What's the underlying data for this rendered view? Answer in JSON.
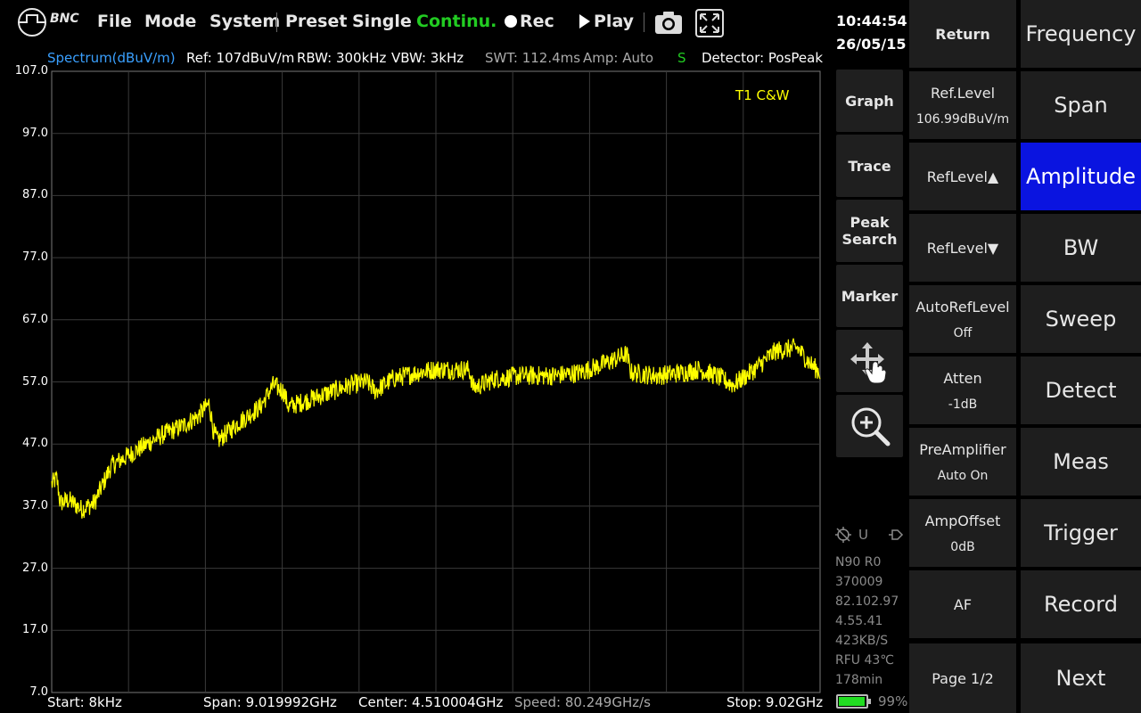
{
  "brand": "BNC",
  "menu": {
    "file": "File",
    "mode": "Mode",
    "system": "System",
    "preset": "Preset",
    "single": "Single",
    "continuous": "Continu.",
    "rec": "Rec",
    "play": "Play"
  },
  "clock": {
    "time": "10:44:54",
    "date": "26/05/15"
  },
  "status": {
    "spectrum": "Spectrum(dBuV/m)",
    "ref": "Ref: 107dBuV/m",
    "rbw": "RBW: 300kHz",
    "vbw": "VBW: 3kHz",
    "swt": "SWT: 112.4ms",
    "amp": "Amp: Auto",
    "s": "S",
    "detector": "Detector: PosPeak"
  },
  "plot": {
    "trace_label": "T1 C&W",
    "y_ticks": [
      "107.0",
      "97.0",
      "87.0",
      "77.0",
      "67.0",
      "57.0",
      "47.0",
      "37.0",
      "27.0",
      "17.0",
      "7.0"
    ]
  },
  "bottom": {
    "start": "Start: 8kHz",
    "span": "Span: 9.019992GHz",
    "center": "Center: 4.510004GHz",
    "speed": "Speed: 80.249GHz/s",
    "stop": "Stop: 9.02GHz"
  },
  "side": {
    "graph": "Graph",
    "trace": "Trace",
    "peak_search": "Peak Search",
    "marker": "Marker"
  },
  "info": {
    "u": "U",
    "lines": [
      "N90 R0",
      "370009",
      "82.102.97",
      "4.55.41",
      "423KB/S",
      "RFU  43℃",
      "178min"
    ],
    "battery": "99%"
  },
  "softkeys": {
    "return": "Return",
    "ref_level": "Ref.Level",
    "ref_level_val": "106.99dBuV/m",
    "ref_up": "RefLevel▲",
    "ref_down": "RefLevel▼",
    "auto_ref": "AutoRefLevel",
    "auto_ref_val": "Off",
    "atten": "Atten",
    "atten_val": "-1dB",
    "preamp": "PreAmplifier",
    "preamp_val": "Auto On",
    "ampoffset": "AmpOffset",
    "ampoffset_val": "0dB",
    "af": "AF",
    "page": "Page 1/2"
  },
  "mainmenu": {
    "frequency": "Frequency",
    "span": "Span",
    "amplitude": "Amplitude",
    "bw": "BW",
    "sweep": "Sweep",
    "detect": "Detect",
    "meas": "Meas",
    "trigger": "Trigger",
    "record": "Record",
    "next": "Next"
  },
  "colors": {
    "trace": "#ffff00",
    "active": "#0a14e0",
    "cont": "#22cc22",
    "spectrum_label": "#3aa0ff"
  },
  "trace_data": {
    "x_unit": "GHz",
    "y_unit": "dBuV/m",
    "points": [
      [
        0.0,
        40.5
      ],
      [
        0.06,
        41.5
      ],
      [
        0.1,
        37.5
      ],
      [
        0.2,
        38.0
      ],
      [
        0.35,
        36.5
      ],
      [
        0.5,
        37.5
      ],
      [
        0.7,
        43.5
      ],
      [
        1.0,
        46.0
      ],
      [
        1.3,
        48.5
      ],
      [
        1.55,
        50.0
      ],
      [
        1.72,
        51.5
      ],
      [
        1.85,
        53.5
      ],
      [
        1.9,
        49.0
      ],
      [
        1.95,
        47.5
      ],
      [
        2.2,
        50.5
      ],
      [
        2.45,
        53.0
      ],
      [
        2.6,
        56.5
      ],
      [
        2.72,
        55.5
      ],
      [
        2.78,
        53.0
      ],
      [
        3.1,
        54.5
      ],
      [
        3.3,
        55.5
      ],
      [
        3.5,
        56.5
      ],
      [
        3.7,
        57.0
      ],
      [
        3.8,
        55.5
      ],
      [
        4.0,
        57.5
      ],
      [
        4.3,
        58.5
      ],
      [
        4.5,
        59.0
      ],
      [
        4.9,
        59.0
      ],
      [
        4.95,
        56.0
      ],
      [
        5.2,
        57.5
      ],
      [
        5.5,
        58.0
      ],
      [
        5.9,
        58.0
      ],
      [
        6.2,
        58.5
      ],
      [
        6.5,
        60.0
      ],
      [
        6.75,
        61.5
      ],
      [
        6.8,
        58.5
      ],
      [
        7.1,
        58.0
      ],
      [
        7.4,
        58.5
      ],
      [
        7.6,
        59.0
      ],
      [
        7.8,
        58.0
      ],
      [
        8.0,
        56.5
      ],
      [
        8.25,
        59.0
      ],
      [
        8.5,
        62.0
      ],
      [
        8.75,
        62.5
      ],
      [
        8.9,
        60.0
      ],
      [
        9.02,
        58.5
      ]
    ]
  }
}
